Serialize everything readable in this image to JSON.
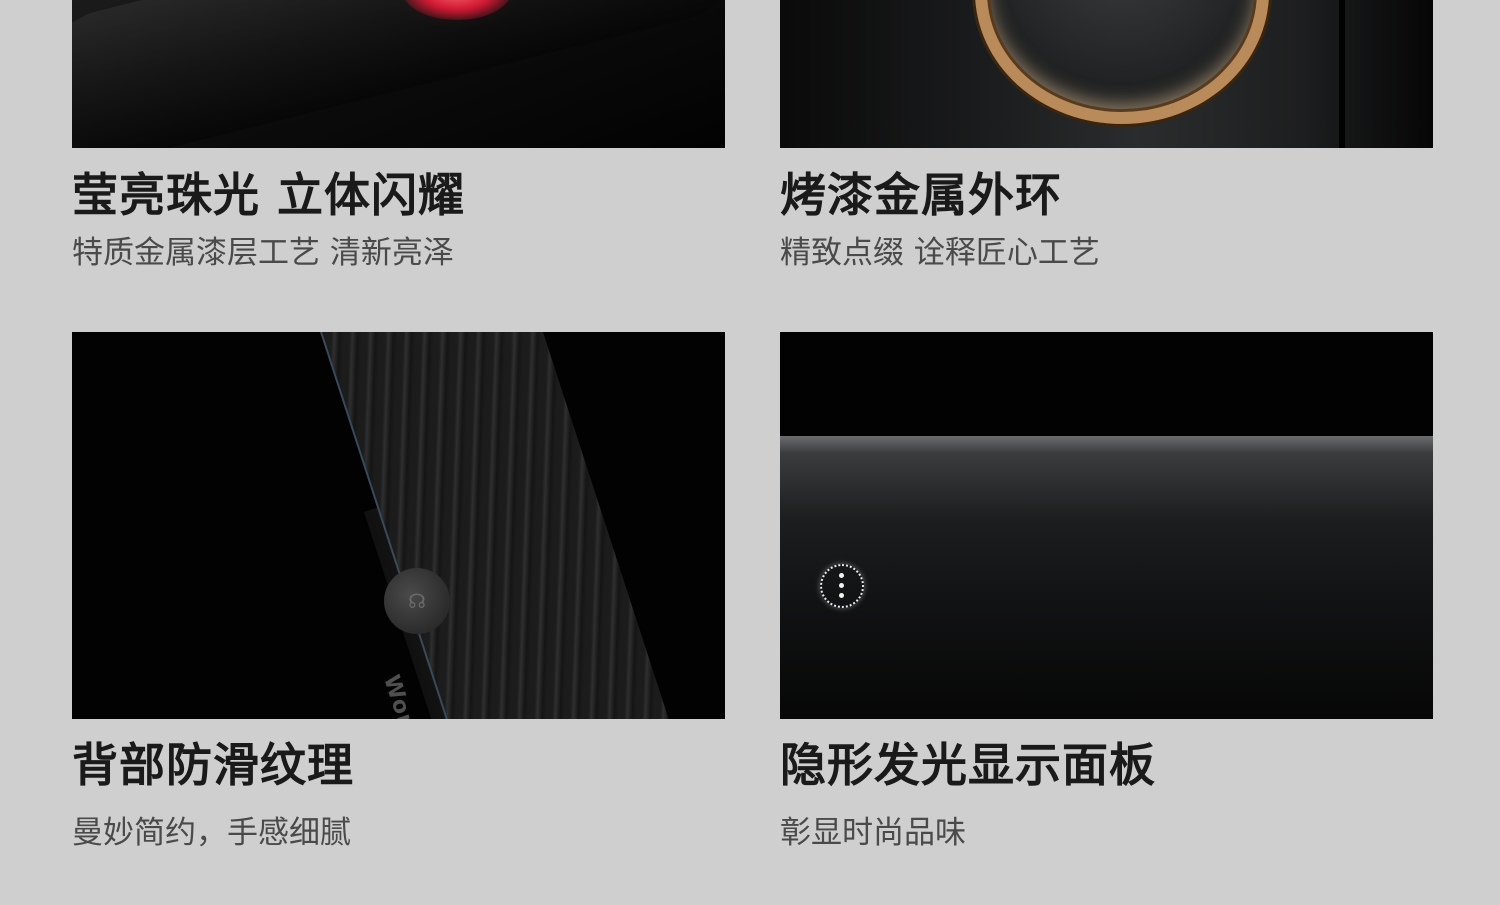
{
  "features": [
    {
      "title": "莹亮珠光 立体闪耀",
      "subtitle": "特质金属漆层工艺 清新亮泽"
    },
    {
      "title": "烤漆金属外环",
      "subtitle": "精致点缀 诠释匠心工艺"
    },
    {
      "title": "背部防滑纹理",
      "subtitle": "曼妙简约，手感细腻",
      "engraving": "Works with HUAWEI"
    },
    {
      "title": "隐形发光显示面板",
      "subtitle": "彰显时尚品味"
    }
  ]
}
